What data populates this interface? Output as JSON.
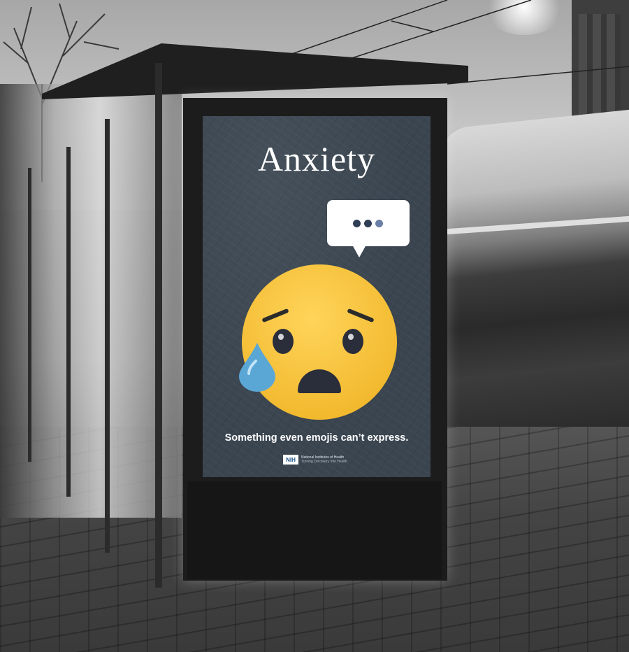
{
  "poster": {
    "title": "Anxiety",
    "tagline": "Something even emojis can’t express.",
    "logo_abbr": "NIH",
    "logo_name": "National Institutes of Health",
    "logo_motto": "Turning Discovery Into Health",
    "emoji_icon": "sad-tear-emoji-icon",
    "bubble_icon": "typing-speech-bubble-icon",
    "colors": {
      "background": "#3a4550",
      "emoji": "#f2b92e",
      "tear": "#5aa7d6",
      "text": "#ffffff"
    }
  }
}
